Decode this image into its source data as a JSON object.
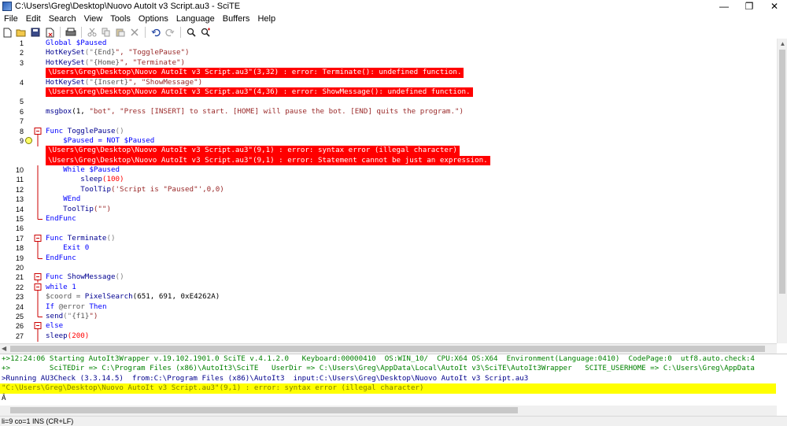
{
  "window": {
    "title": "C:\\Users\\Greg\\Desktop\\Nuovo AutoIt v3 Script.au3 - SciTE"
  },
  "menu": [
    "File",
    "Edit",
    "Search",
    "View",
    "Tools",
    "Options",
    "Language",
    "Buffers",
    "Help"
  ],
  "toolbar": [
    "new-file-icon",
    "open-file-icon",
    "save-icon",
    "close-file-icon",
    "print-icon",
    "cut-icon",
    "copy-icon",
    "paste-icon",
    "delete-icon",
    "undo-icon",
    "redo-icon",
    "find-icon",
    "replace-icon"
  ],
  "editor": {
    "lines": [
      {
        "n": "1",
        "tokens": [
          {
            "t": "Global $Paused",
            "c": "kw"
          }
        ]
      },
      {
        "n": "2",
        "tokens": [
          {
            "t": "HotKeySet",
            "c": "fn"
          },
          {
            "t": "(\"",
            "c": "op"
          },
          {
            "t": "{End}",
            "c": "var"
          },
          {
            "t": "\", \"TogglePause\")",
            "c": "str"
          }
        ]
      },
      {
        "n": "3",
        "tokens": [
          {
            "t": "HotKeySet",
            "c": "fn"
          },
          {
            "t": "(\"",
            "c": "op"
          },
          {
            "t": "{Home}",
            "c": "var"
          },
          {
            "t": "\", \"Terminate\")",
            "c": "str"
          }
        ]
      },
      {
        "err": "\\Users\\Greg\\Desktop\\Nuovo AutoIt v3 Script.au3\"(3,32) : error: Terminate(): undefined function."
      },
      {
        "n": "4",
        "tokens": [
          {
            "t": "HotKeySet",
            "c": "fn"
          },
          {
            "t": "(\"",
            "c": "op"
          },
          {
            "t": "{Insert}",
            "c": "var"
          },
          {
            "t": "\", \"ShowMessage\")",
            "c": "str"
          }
        ]
      },
      {
        "err": "\\Users\\Greg\\Desktop\\Nuovo AutoIt v3 Script.au3\"(4,36) : error: ShowMessage(): undefined function."
      },
      {
        "n": "5",
        "tokens": []
      },
      {
        "n": "6",
        "tokens": [
          {
            "t": "msgbox",
            "c": "fn"
          },
          {
            "t": "(1, ",
            "c": "num"
          },
          {
            "t": "\"bot\", \"Press [INSERT] to start. [HOME] will pause the bot. [END] quits the program.\")",
            "c": "str"
          }
        ]
      },
      {
        "n": "7",
        "tokens": []
      },
      {
        "n": "8",
        "fold": "box",
        "tokens": [
          {
            "t": "Func ",
            "c": "kw"
          },
          {
            "t": "TogglePause",
            "c": "fn"
          },
          {
            "t": "()",
            "c": "op"
          }
        ]
      },
      {
        "n": "9",
        "fold": "line",
        "marker": true,
        "tokens": [
          {
            "t": "    $Paused = NOT $Paused",
            "c": "kw"
          }
        ]
      },
      {
        "err": "\\Users\\Greg\\Desktop\\Nuovo AutoIt v3 Script.au3\"(9,1) : error: syntax error (illegal character)"
      },
      {
        "err": "\\Users\\Greg\\Desktop\\Nuovo AutoIt v3 Script.au3\"(9,1) : error: Statement cannot be just an expression."
      },
      {
        "n": "10",
        "fold": "line",
        "tokens": [
          {
            "t": "    While $Paused",
            "c": "kw"
          }
        ]
      },
      {
        "n": "11",
        "fold": "line",
        "tokens": [
          {
            "t": "        sleep",
            "c": "fn"
          },
          {
            "t": "(100)",
            "c": "red"
          }
        ]
      },
      {
        "n": "12",
        "fold": "line",
        "tokens": [
          {
            "t": "        ToolTip",
            "c": "fn"
          },
          {
            "t": "('Script is \"Paused\"',0,0)",
            "c": "str"
          }
        ]
      },
      {
        "n": "13",
        "fold": "line",
        "tokens": [
          {
            "t": "    WEnd",
            "c": "kw"
          }
        ]
      },
      {
        "n": "14",
        "fold": "line",
        "tokens": [
          {
            "t": "    ToolTip",
            "c": "fn"
          },
          {
            "t": "(\"\")",
            "c": "str"
          }
        ]
      },
      {
        "n": "15",
        "fold": "end",
        "tokens": [
          {
            "t": "EndFunc",
            "c": "kw"
          }
        ]
      },
      {
        "n": "16",
        "tokens": []
      },
      {
        "n": "17",
        "fold": "box",
        "tokens": [
          {
            "t": "Func ",
            "c": "kw"
          },
          {
            "t": "Terminate",
            "c": "fn"
          },
          {
            "t": "()",
            "c": "op"
          }
        ]
      },
      {
        "n": "18",
        "fold": "line",
        "tokens": [
          {
            "t": "    Exit 0",
            "c": "kw"
          }
        ]
      },
      {
        "n": "19",
        "fold": "end",
        "tokens": [
          {
            "t": "EndFunc",
            "c": "kw"
          }
        ]
      },
      {
        "n": "20",
        "tokens": []
      },
      {
        "n": "21",
        "fold": "box",
        "tokens": [
          {
            "t": "Func ",
            "c": "kw"
          },
          {
            "t": "ShowMessage",
            "c": "fn"
          },
          {
            "t": "()",
            "c": "op"
          }
        ]
      },
      {
        "n": "22",
        "fold": "box",
        "tokens": [
          {
            "t": "while 1",
            "c": "kw"
          }
        ]
      },
      {
        "n": "23",
        "fold": "line",
        "tokens": [
          {
            "t": "$coord = ",
            "c": "var"
          },
          {
            "t": "PixelSearch",
            "c": "fn"
          },
          {
            "t": "(651, 691, 0xE4262A)",
            "c": "num"
          }
        ]
      },
      {
        "n": "24",
        "fold": "line",
        "tokens": [
          {
            "t": "If ",
            "c": "kw"
          },
          {
            "t": "@error",
            "c": "var"
          },
          {
            "t": " Then",
            "c": "kw"
          }
        ]
      },
      {
        "n": "25",
        "fold": "end",
        "tokens": [
          {
            "t": "send",
            "c": "fn"
          },
          {
            "t": "(\"",
            "c": "op"
          },
          {
            "t": "{f1}",
            "c": "var"
          },
          {
            "t": "\")",
            "c": "str"
          }
        ]
      },
      {
        "n": "26",
        "fold": "box",
        "tokens": [
          {
            "t": "else",
            "c": "kw"
          }
        ]
      },
      {
        "n": "27",
        "fold": "line",
        "tokens": [
          {
            "t": "sleep",
            "c": "fn"
          },
          {
            "t": "(200)",
            "c": "red"
          }
        ]
      }
    ]
  },
  "output": {
    "lines": [
      {
        "c": "o-green",
        "t": "+>12:24:06 Starting AutoIt3Wrapper v.19.102.1901.0 SciTE v.4.1.2.0   Keyboard:00000410  OS:WIN_10/  CPU:X64 OS:X64  Environment(Language:0410)  CodePage:0  utf8.auto.check:4"
      },
      {
        "c": "o-green",
        "t": "+>         SciTEDir => C:\\Program Files (x86)\\AutoIt3\\SciTE   UserDir => C:\\Users\\Greg\\AppData\\Local\\AutoIt v3\\SciTE\\AutoIt3Wrapper   SCITE_USERHOME => C:\\Users\\Greg\\AppData"
      },
      {
        "c": "o-blue",
        "t": ">Running AU3Check (3.3.14.5)  from:C:\\Program Files (x86)\\AutoIt3  input:C:\\Users\\Greg\\Desktop\\Nuovo AutoIt v3 Script.au3"
      },
      {
        "c": "o-yellow",
        "t": "\"C:\\Users\\Greg\\Desktop\\Nuovo AutoIt v3 Script.au3\"(9,1) : error: syntax error (illegal character)"
      },
      {
        "c": "o-plain",
        "t": "Â"
      }
    ]
  },
  "status": {
    "text": "li=9 co=1 INS (CR+LF)"
  }
}
